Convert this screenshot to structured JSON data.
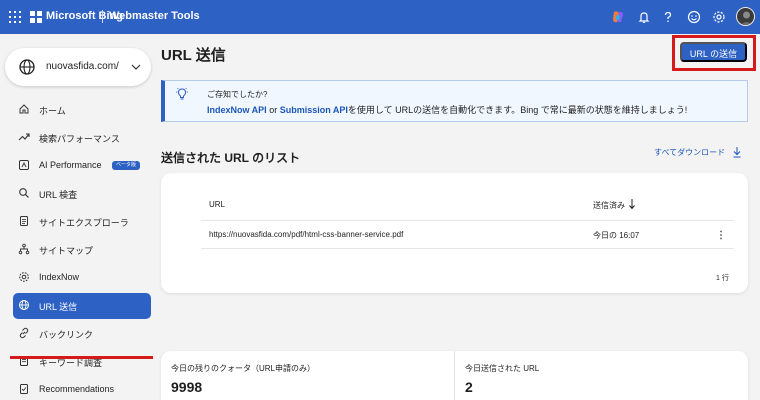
{
  "topbar": {
    "brand": "Microsoft Bing",
    "product": "Webmaster Tools",
    "icons": [
      "waffle-icon",
      "copilot-icon",
      "bell-icon",
      "help-icon",
      "feedback-icon",
      "settings-icon",
      "avatar"
    ]
  },
  "sidebar": {
    "site": "nuovasfida.com/",
    "items": [
      {
        "label": "ホーム",
        "icon": "home-icon"
      },
      {
        "label": "検索パフォーマンス",
        "icon": "trend-icon"
      },
      {
        "label": "AI Performance",
        "icon": "ai-icon",
        "badge": "ベータ版"
      },
      {
        "label": "URL 検査",
        "icon": "search-icon"
      },
      {
        "label": "サイトエクスプローラ",
        "icon": "document-icon"
      },
      {
        "label": "サイトマップ",
        "icon": "sitemap-icon"
      },
      {
        "label": "IndexNow",
        "icon": "gear-icon"
      },
      {
        "label": "URL 送信",
        "icon": "globe-icon"
      },
      {
        "label": "バックリンク",
        "icon": "link-icon"
      },
      {
        "label": "キーワード調査",
        "icon": "keyword-icon"
      },
      {
        "label": "Recommendations",
        "icon": "recommend-icon"
      }
    ],
    "active_index": 7
  },
  "main": {
    "title": "URL 送信",
    "submit_button": "URL の送信",
    "banner": {
      "line1": "ご存知でしたか?",
      "link1": "IndexNow API",
      "or": " or ",
      "link2": "Submission API",
      "rest": "を使用して URLの送信を自動化できます。Bing で常に最新の状態を維持しましょう!"
    },
    "list_title": "送信された URL のリスト",
    "download_all": "すべてダウンロード",
    "table": {
      "col_url": "URL",
      "col_date": "送信済み",
      "rows": [
        {
          "url": "https://nuovasfida.com/pdf/html-css-banner-service.pdf",
          "date": "今日の 16:07"
        }
      ],
      "row_count": "1 行"
    },
    "quota": {
      "remaining_label": "今日の残りのクォータ（URL申請のみ）",
      "remaining_value": "9998",
      "submitted_label": "今日送信された URL",
      "submitted_value": "2"
    }
  },
  "colors": {
    "accent": "#2d61c4",
    "highlight": "#d6191b",
    "banner_bg": "#f1f7ff",
    "link": "#1a56b8"
  }
}
